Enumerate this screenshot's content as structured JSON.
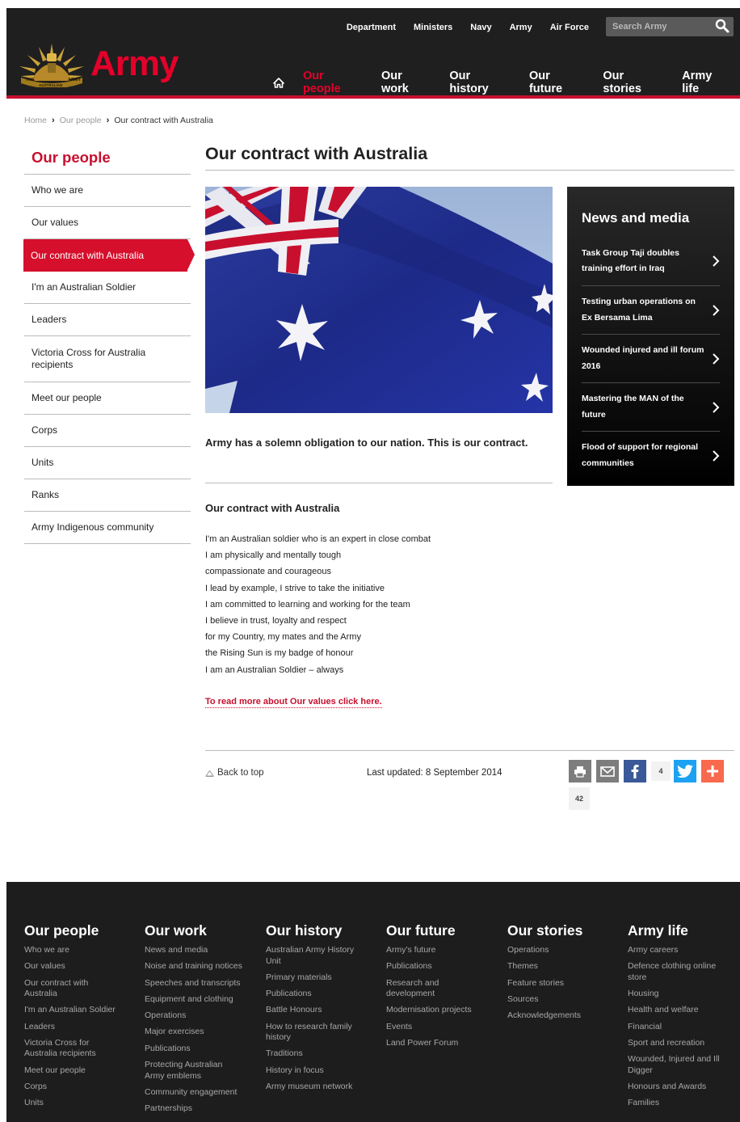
{
  "header": {
    "utility_nav": [
      "Department",
      "Ministers",
      "Navy",
      "Army",
      "Air Force"
    ],
    "search_placeholder": "Search Army",
    "logo_text": "Army",
    "logo_emblem_text": [
      "THE",
      "ARMY",
      "AUSTRALIAN"
    ],
    "main_nav": [
      {
        "label": "Our people",
        "active": true
      },
      {
        "label": "Our work",
        "active": false
      },
      {
        "label": "Our history",
        "active": false
      },
      {
        "label": "Our future",
        "active": false
      },
      {
        "label": "Our stories",
        "active": false
      },
      {
        "label": "Army life",
        "active": false
      }
    ]
  },
  "breadcrumb": [
    "Home",
    "Our people",
    "Our contract with Australia"
  ],
  "sidebar": {
    "title": "Our people",
    "items": [
      {
        "label": "Who we are",
        "active": false
      },
      {
        "label": "Our values",
        "active": false
      },
      {
        "label": "Our contract with Australia",
        "active": true
      },
      {
        "label": "I'm an Australian Soldier",
        "active": false
      },
      {
        "label": "Leaders",
        "active": false
      },
      {
        "label": "Victoria Cross for Australia recipients",
        "active": false
      },
      {
        "label": "Meet our people",
        "active": false
      },
      {
        "label": "Corps",
        "active": false
      },
      {
        "label": "Units",
        "active": false
      },
      {
        "label": "Ranks",
        "active": false
      },
      {
        "label": "Army Indigenous community",
        "active": false
      }
    ]
  },
  "main": {
    "title": "Our contract with Australia",
    "lead": "Army has a solemn obligation to our nation. This is our contract.",
    "section_heading": "Our contract with Australia",
    "creed": [
      "I'm an Australian soldier who is an expert in close combat",
      "I am physically and mentally tough",
      "compassionate and courageous",
      "I lead by example, I strive to take the initiative",
      "I am committed to learning and working for the team",
      "I believe in trust, loyalty and respect",
      "for my Country, my mates and the Army",
      "the Rising Sun is my badge of honour",
      "I am an Australian Soldier – always"
    ],
    "values_link": "To read more about Our values click here.",
    "back_to_top": "Back to top",
    "last_updated": "Last updated: 8 September 2014",
    "share": {
      "facebook_count": "4",
      "addthis_count": "42"
    }
  },
  "news": {
    "title": "News and media",
    "items": [
      "Task Group Taji doubles training effort in Iraq",
      "Testing urban operations on Ex Bersama Lima",
      "Wounded injured and ill forum 2016",
      "Mastering the MAN of the future",
      "Flood of support for regional communities"
    ]
  },
  "footer": {
    "columns": [
      {
        "title": "Our people",
        "links": [
          "Who we are",
          "Our values",
          "Our contract with Australia",
          "I'm an Australian Soldier",
          "Leaders",
          "Victoria Cross for Australia recipients",
          "Meet our people",
          "Corps",
          "Units"
        ]
      },
      {
        "title": "Our work",
        "links": [
          "News and media",
          "Noise and training notices",
          "Speeches and transcripts",
          "Equipment and clothing",
          "Operations",
          "Major exercises",
          "Publications",
          "Protecting Australian Army emblems",
          "Community engagement",
          "Partnerships"
        ]
      },
      {
        "title": "Our history",
        "links": [
          "Australian Army History Unit",
          "Primary materials",
          "Publications",
          "Battle Honours",
          "How to research family history",
          "Traditions",
          "History in focus",
          "Army museum network"
        ]
      },
      {
        "title": "Our future",
        "links": [
          "Army's future",
          "Publications",
          "Research and development",
          "Modernisation projects",
          "Events",
          "Land Power Forum"
        ]
      },
      {
        "title": "Our stories",
        "links": [
          "Operations",
          "Themes",
          "Feature stories",
          "Sources",
          "Acknowledgements"
        ]
      },
      {
        "title": "Army life",
        "links": [
          "Army careers",
          "Defence clothing online store",
          "Housing",
          "Health and welfare",
          "Financial",
          "Sport and recreation",
          "Wounded, Injured and Ill Digger",
          "Honours and Awards",
          "Families"
        ]
      }
    ]
  },
  "colors": {
    "accent": "#c8102e",
    "header_bg": "#1f1f1f",
    "facebook": "#3b5998",
    "twitter": "#1da1f2",
    "addthis": "#f8694d"
  }
}
